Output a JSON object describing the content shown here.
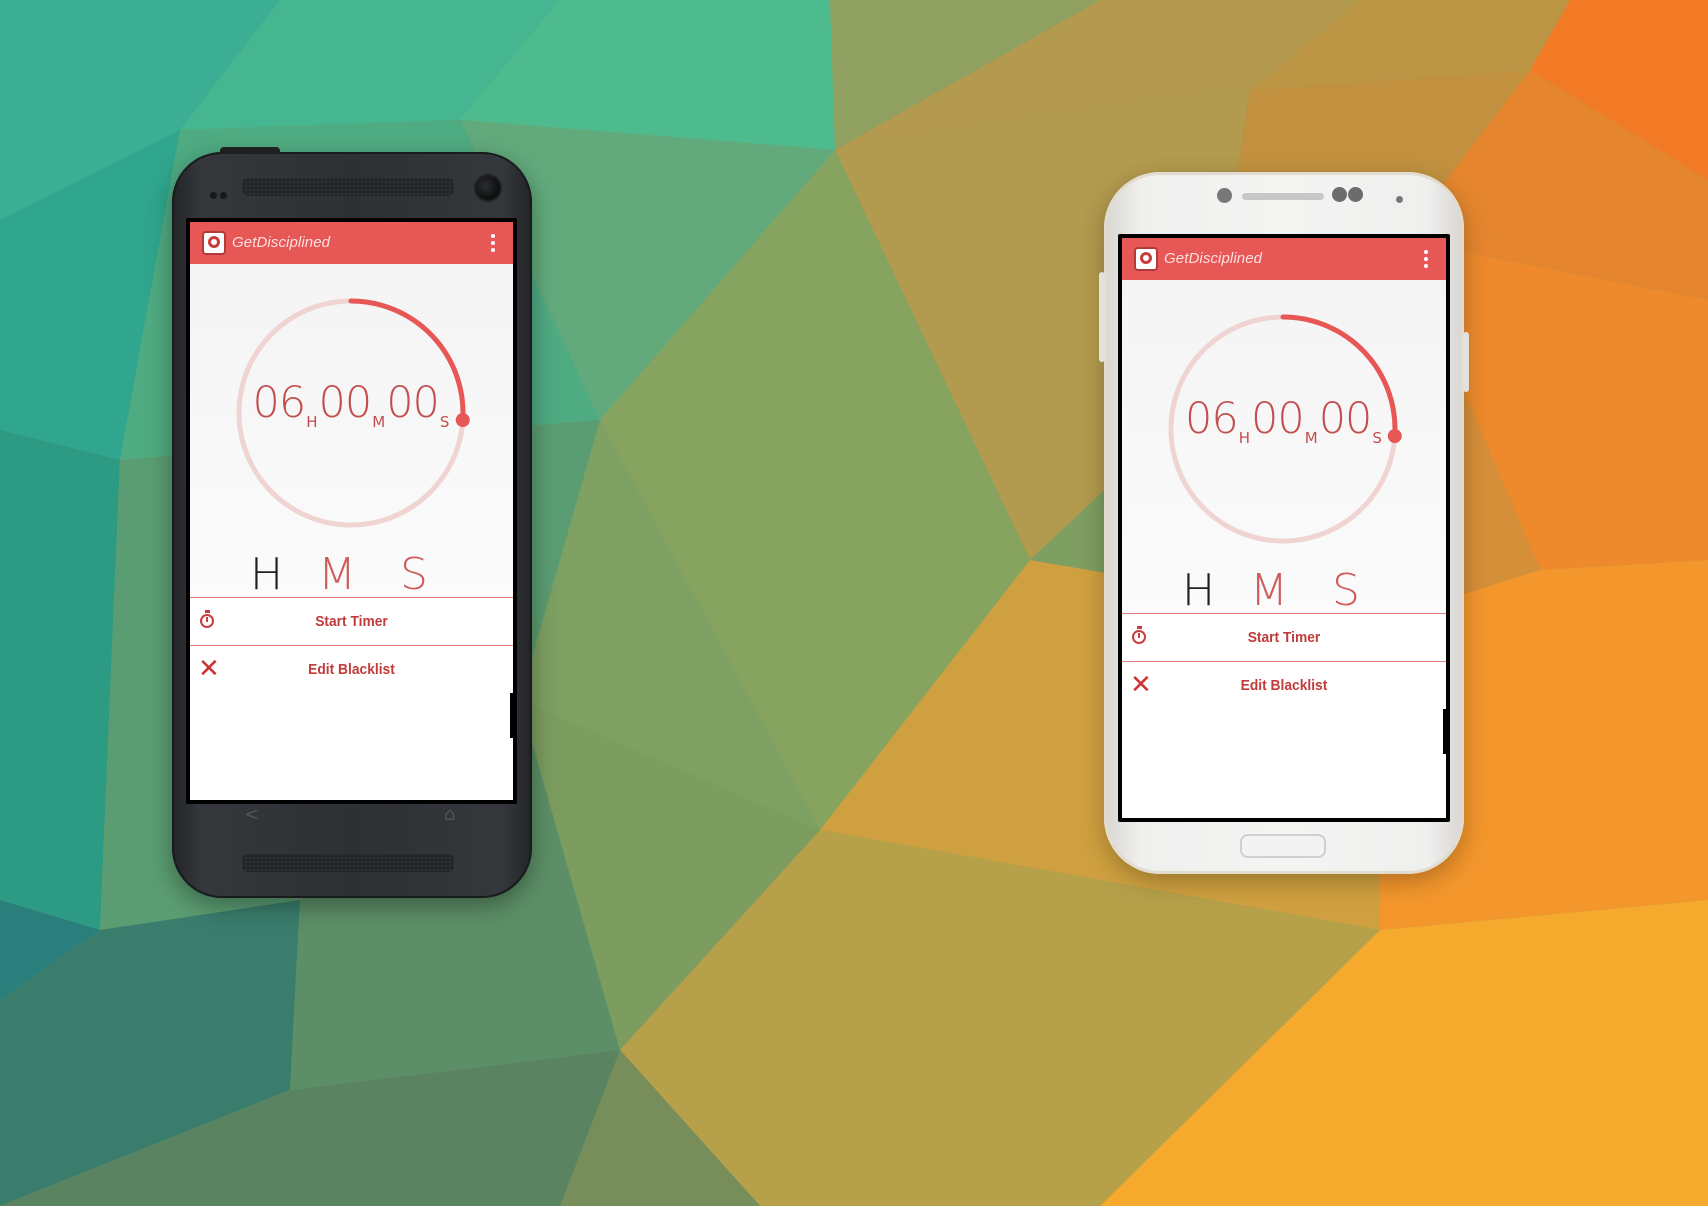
{
  "colors": {
    "accent": "#e65756",
    "accent_text": "#c23b3b",
    "ring_track": "#f0d4d2",
    "ring_progress": "#e65756"
  },
  "app": {
    "title": "GetDisciplined",
    "menu_icon": "overflow-menu-icon",
    "logo_icon": "app-logo-icon"
  },
  "timer": {
    "hours": "06",
    "minutes": "00",
    "seconds": "00",
    "hours_unit": "H",
    "minutes_unit": "M",
    "seconds_unit": "S",
    "progress_fraction": 0.26
  },
  "selector": {
    "h": "H",
    "m": "M",
    "s": "S",
    "active": "H"
  },
  "actions": {
    "start_timer": "Start Timer",
    "start_timer_icon": "stopwatch-icon",
    "edit_blacklist": "Edit Blacklist",
    "edit_blacklist_icon": "close-x-icon"
  },
  "device_nav": {
    "back_icon": "back-nav-icon",
    "home_icon": "home-nav-icon"
  }
}
